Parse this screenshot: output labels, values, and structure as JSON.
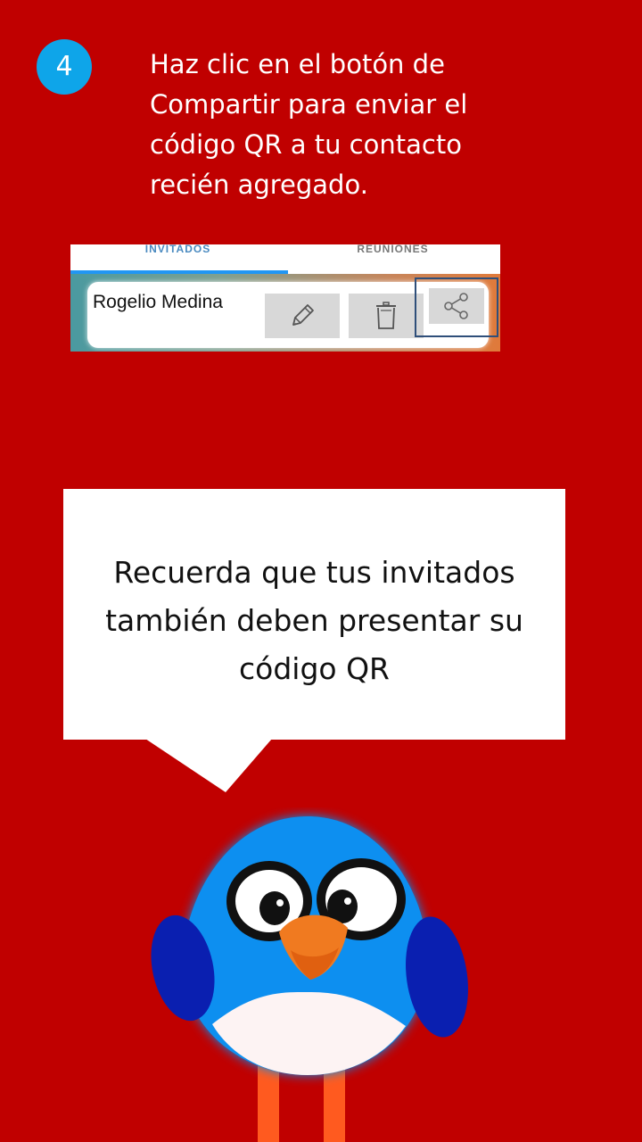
{
  "step": {
    "number": "4",
    "instruction_lines": [
      "Haz clic en el botón de",
      "Compartir para enviar el",
      "código QR a tu contacto",
      "recién agregado."
    ]
  },
  "app_screenshot": {
    "tabs": [
      {
        "label": "INVITADOS",
        "active": true
      },
      {
        "label": "REUNIONES",
        "active": false
      }
    ],
    "contact": {
      "name": "Rogelio Medina",
      "actions": [
        {
          "icon": "pencil-icon",
          "label": "edit"
        },
        {
          "icon": "trash-icon",
          "label": "delete"
        },
        {
          "icon": "share-icon",
          "label": "share"
        }
      ]
    }
  },
  "bubble": {
    "lines": [
      "Recuerda que tus invitados",
      "también deben presentar su",
      "código QR"
    ]
  },
  "colors": {
    "background": "#c00000",
    "badge": "#0ea5e9",
    "tab_active": "#2196f3",
    "mascot_body": "#0a8ff0",
    "mascot_wing": "#0a1fb0",
    "mascot_beak": "#f07a20"
  }
}
